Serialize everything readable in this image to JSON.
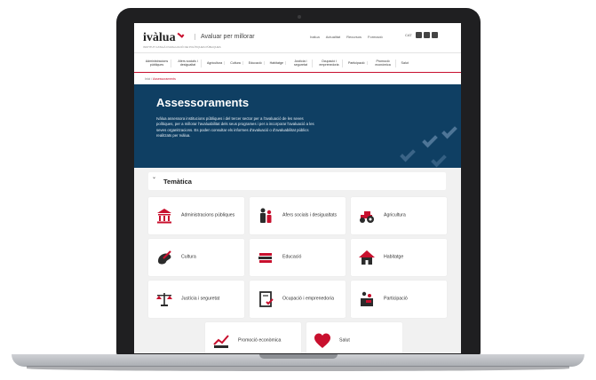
{
  "colors": {
    "accent": "#c8102e",
    "hero_bg": "#0f3f63",
    "icon_dark": "#2b2b2b"
  },
  "header": {
    "logo_text": "ivàlua",
    "logo_sub": "INSTITUT CATALÀ D'AVALUACIÓ DE POLÍTIQUES PÚBLIQUES",
    "tagline": "Avaluar per millorar",
    "top_links": [
      "Ivàlua",
      "Actualitat",
      "Recursos",
      "Formació"
    ],
    "lang": "CAT",
    "social": [
      "linkedin-icon",
      "twitter-icon",
      "youtube-icon"
    ]
  },
  "nav": {
    "items": [
      "Administracions públiques",
      "Afers socials i desigualtat",
      "Agricultura",
      "Cultura",
      "Educació",
      "Habitatge",
      "Justícia i seguretat",
      "Ocupació i emprenedoria",
      "Participació",
      "Promoció econòmica",
      "Salut"
    ]
  },
  "breadcrumb": {
    "home": "Inici",
    "sep": "/",
    "current": "Assessoraments"
  },
  "hero": {
    "title": "Assessoraments",
    "text": "Ivàlua assessora institucions públiques i del tercer sector per a l'avaluació de les seves polítiques, per a millorar l'avaluabilitat dels seus programes i per a incorporar l'avaluació a les seves organitzacions. Es poden consultar els informes d'avaluació o d'avaluabilitat públics realitzats per Ivàlua."
  },
  "accordion": {
    "chevron": "⌄",
    "title": "Temàtica"
  },
  "tiles": [
    {
      "label": "Administracions públiques",
      "icon": "government-building-icon"
    },
    {
      "label": "Afers socials i desigualtats",
      "icon": "people-icon"
    },
    {
      "label": "Agricultura",
      "icon": "tractor-icon"
    },
    {
      "label": "Cultura",
      "icon": "palette-icon"
    },
    {
      "label": "Educació",
      "icon": "books-icon"
    },
    {
      "label": "Habitatge",
      "icon": "house-icon"
    },
    {
      "label": "Justícia i seguretat",
      "icon": "scales-icon"
    },
    {
      "label": "Ocupació i emprenedoria",
      "icon": "document-check-icon"
    },
    {
      "label": "Participació",
      "icon": "podium-icon"
    },
    {
      "label": "Promoció econòmica",
      "icon": "chart-growth-icon"
    },
    {
      "label": "Salut",
      "icon": "heart-icon"
    }
  ]
}
